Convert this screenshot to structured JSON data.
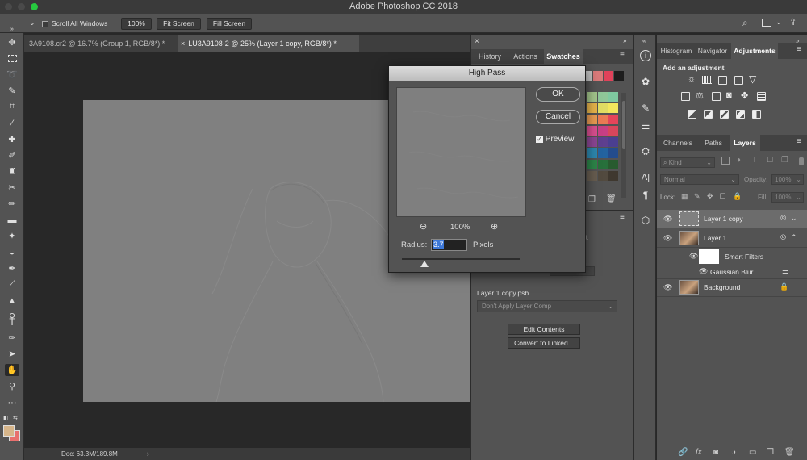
{
  "app": {
    "title": "Adobe Photoshop CC 2018"
  },
  "options_bar": {
    "scroll_all_windows": "Scroll All Windows",
    "zoom_btn": "100%",
    "fit_screen": "Fit Screen",
    "fill_screen": "Fill Screen"
  },
  "doc_tabs": [
    {
      "label": "3A9108.cr2 @ 16.7% (Group 1, RGB/8*) *"
    },
    {
      "label": "LU3A9108-2 @ 25% (Layer 1 copy, RGB/8*) *"
    }
  ],
  "status": {
    "doc": "Doc: 63.3M/189.8M"
  },
  "mid_panel": {
    "tabs": [
      "History",
      "Actions",
      "Swatches"
    ],
    "smart_object_name": "Layer 1 copy.psb",
    "layer_comp": "Don't Apply Layer Comp",
    "edit_contents": "Edit Contents",
    "convert_linked": "Convert to Linked...",
    "partial_tab": "t"
  },
  "swatch_colors": [
    "#c4c4c4",
    "#d97a7a",
    "#e0425a",
    "#1d1d1d"
  ],
  "swatch_grid": [
    [
      "#a2c48a",
      "#8fc698",
      "#7fc9a0"
    ],
    [
      "#e6b34a",
      "#e0dc62",
      "#f2e75c"
    ],
    [
      "#e89a51",
      "#ea7a54",
      "#e4455a"
    ],
    [
      "#d84e8f",
      "#c73f85",
      "#d8465c"
    ],
    [
      "#8a4592",
      "#5e3f8f",
      "#4b3f91"
    ],
    [
      "#2c86ad",
      "#2363a0",
      "#244c8d"
    ],
    [
      "#2c8448",
      "#27703b",
      "#285b2f"
    ],
    [
      "#665c4f",
      "#524a3f",
      "#3f382f"
    ]
  ],
  "right_panel": {
    "top_tabs": [
      "Histogram",
      "Navigator",
      "Adjustments"
    ],
    "add_adjustment": "Add an adjustment",
    "layer_tabs": [
      "Channels",
      "Paths",
      "Layers"
    ],
    "kind_filter": "Kind",
    "blend_mode": "Normal",
    "opacity_label": "Opacity:",
    "opacity_value": "100%",
    "lock_label": "Lock:",
    "fill_label": "Fill:",
    "fill_value": "100%",
    "layers": [
      {
        "name": "Layer 1 copy"
      },
      {
        "name": "Layer 1"
      },
      {
        "name": "Smart Filters"
      },
      {
        "name": "Gaussian Blur"
      },
      {
        "name": "Background"
      }
    ]
  },
  "dialog": {
    "title": "High Pass",
    "ok": "OK",
    "cancel": "Cancel",
    "preview_label": "Preview",
    "preview_checked": true,
    "zoom": "100%",
    "radius_label": "Radius:",
    "radius_value": "3.7",
    "units": "Pixels",
    "slider_position": 0.19
  }
}
